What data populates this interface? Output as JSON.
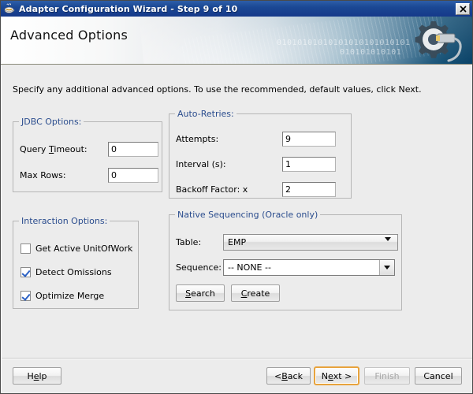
{
  "window": {
    "title": "Adapter Configuration Wizard - Step 9 of 10",
    "title_icon": "java-cup-icon",
    "close_label": "✕"
  },
  "banner": {
    "heading": "Advanced Options",
    "binary_line_1": "01010101010101010101010101",
    "binary_line_2": "010101010101",
    "graphic": "gear-plug-icon"
  },
  "main": {
    "instruction": "Specify any additional advanced options.  To use the recommended, default values, click Next."
  },
  "jdbc": {
    "legend": "JDBC Options:",
    "query_timeout_label_pre": "Query ",
    "query_timeout_label_mn": "T",
    "query_timeout_label_post": "imeout:",
    "query_timeout_value": "0",
    "max_rows_label": "Max Rows:",
    "max_rows_value": "0"
  },
  "retries": {
    "legend": "Auto-Retries:",
    "attempts_label": "Attempts:",
    "attempts_value": "9",
    "interval_label": "Interval (s):",
    "interval_value": "1",
    "backoff_label": "Backoff Factor: x",
    "backoff_value": "2"
  },
  "interaction": {
    "legend": "Interaction Options:",
    "items": [
      {
        "label": "Get Active UnitOfWork",
        "checked": false
      },
      {
        "label": "Detect Omissions",
        "checked": true
      },
      {
        "label": "Optimize Merge",
        "checked": true
      }
    ]
  },
  "sequencing": {
    "legend": "Native Sequencing (Oracle only)",
    "table_label": "Table:",
    "table_value": "EMP",
    "sequence_label": "Sequence:",
    "sequence_value": "-- NONE --",
    "search_mn": "S",
    "search_rest": "earch",
    "create_mn": "C",
    "create_rest": "reate"
  },
  "footer": {
    "help_pre": "H",
    "help_mn": "e",
    "help_post": "lp",
    "back_pre": "< ",
    "back_mn": "B",
    "back_post": "ack",
    "next_pre": "N",
    "next_mn": "e",
    "next_post": "xt >",
    "finish_label": "Finish",
    "cancel_label": "Cancel"
  },
  "colors": {
    "legend_blue": "#2b4d8e",
    "titlebar_blue": "#1b4894",
    "focus_orange": "#e8a33d",
    "check_blue": "#2b61c4"
  }
}
